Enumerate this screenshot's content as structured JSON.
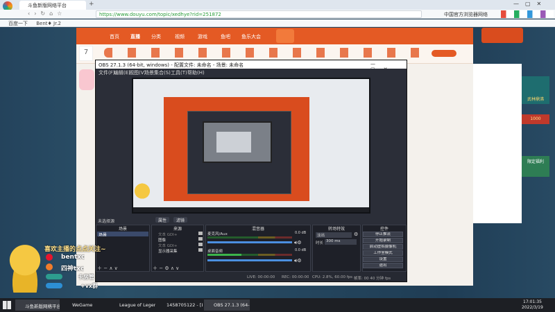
{
  "browser": {
    "tab_title": "斗鱼新版网络平台",
    "url": "https://www.douyu.com/topic/xedhye?rid=251872",
    "security_note": "中国官方浏览器网络",
    "bookmarks": [
      "百度一下",
      "Bent♦ Jr.2"
    ]
  },
  "site": {
    "nav": [
      "首页",
      "直播",
      "分类",
      "视频",
      "游戏",
      "鱼吧",
      "鱼乐大会"
    ],
    "nav_active": "直播",
    "rank": "7",
    "right_cards": [
      "武林鼎沸",
      "1000",
      "限定福利"
    ]
  },
  "obs": {
    "title": "OBS 27.1.3 (64-bit, windows) - 配置文件: 未命名 - 场景: 未命名",
    "menu": [
      "文件(F)",
      "编辑(E)",
      "视图(V)",
      "场景集合(S)",
      "工具(T)",
      "帮助(H)"
    ],
    "no_source": "未选择源",
    "props_btn": "属性",
    "filter_btn": "滤镜",
    "panels": {
      "scenes": "场景",
      "sources": "来源",
      "mixer": "混音器",
      "transitions": "转场特效",
      "controls": "控件"
    },
    "scene_items": [
      "场景"
    ],
    "source_items": [
      "文本 GDI+",
      "图像",
      "文本 GDI+",
      "显示器采集"
    ],
    "mixer_tracks": [
      {
        "name": "麦克风/Aux",
        "db": "0.0 dB"
      },
      {
        "name": "桌面音频",
        "db": "0.0 dB"
      }
    ],
    "transition": {
      "type": "淡出",
      "duration_label": "时长",
      "duration": "300 ms"
    },
    "controls": [
      "停止推流",
      "开始录制",
      "启动虚拟摄像机",
      "工作室模式",
      "设置",
      "退出"
    ],
    "status": {
      "live": "LIVE: 00:00:00",
      "rec": "REC: 00:00:00",
      "cpu": "CPU: 2.8%, 60.00 fps",
      "dropped": "帧率: 00 40 分钟 fps"
    }
  },
  "overlay": {
    "follow": "喜欢主播的点点关注~",
    "name1": "bentxc",
    "name2": "四神txc",
    "badge1": "卡房管",
    "badge2": "+vx群"
  },
  "taskbar": {
    "items": [
      "斗鱼新版网络平台",
      "WeGame",
      "League of Legends",
      "1458705122 - [LOL...",
      "OBS 27.1.3 (64-bi..."
    ],
    "time": "17:01:35",
    "date": "2022/3/19"
  },
  "colors": {
    "douyu_orange": "#e45a24",
    "obs_dark": "#2b2e38",
    "meter_green": "#3cb44b"
  }
}
